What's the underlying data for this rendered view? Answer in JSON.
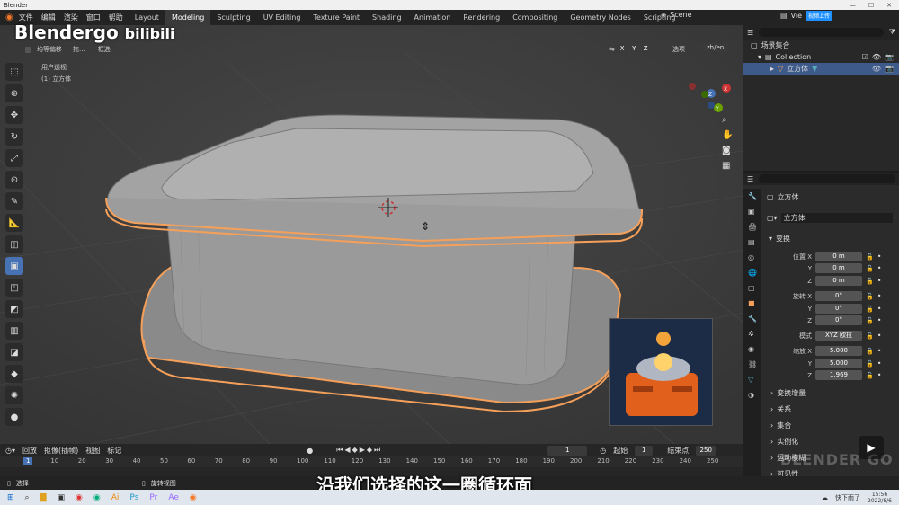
{
  "window": {
    "title": "Blender"
  },
  "menu": [
    "文件",
    "编辑",
    "渲染",
    "窗口",
    "帮助"
  ],
  "workspaces": [
    "Layout",
    "Modeling",
    "Sculpting",
    "UV Editing",
    "Texture Paint",
    "Shading",
    "Animation",
    "Rendering",
    "Compositing",
    "Geometry Nodes",
    "Scripting"
  ],
  "active_workspace": "Modeling",
  "scene": "Scene",
  "view_layer_btn": "Vie",
  "view_layer_badge": "视频上传",
  "watermark_logo": "Blendergo",
  "bilibili_logo": "bilibili",
  "viewport": {
    "options": [
      "均等偏移",
      "拖...",
      "框选"
    ],
    "view_label": "用户透视",
    "object_label": "(1) 立方体",
    "axes": [
      "X",
      "Y",
      "Z"
    ],
    "options_btn": "选项",
    "lang": "zh/en"
  },
  "outliner": {
    "root": "场景集合",
    "collection": "Collection",
    "object": "立方体"
  },
  "properties": {
    "header": "立方体",
    "object_name": "立方体",
    "section_transform": "变换",
    "location_label": "位置 X",
    "location": [
      "0 m",
      "0 m",
      "0 m"
    ],
    "rotation_label": "旋转 X",
    "rotation": [
      "0°",
      "0°",
      "0°"
    ],
    "mode_label": "模式",
    "mode_value": "XYZ 欧拉",
    "scale_label": "缩放 X",
    "scale": [
      "5.000",
      "5.000",
      "1.969"
    ],
    "y": "Y",
    "z": "Z",
    "delta": "变换增量",
    "sections": [
      "关系",
      "集合",
      "实例化",
      "运动模糊",
      "可见性"
    ]
  },
  "timeline": {
    "playback": "回放",
    "keying": "抠像(插帧)",
    "view": "视图",
    "markers": "标记",
    "current_frame": "1",
    "start_label": "起始",
    "start": "1",
    "end_label": "结束点",
    "end": "250",
    "ticks": [
      "1",
      "10",
      "20",
      "30",
      "40",
      "50",
      "60",
      "70",
      "80",
      "90",
      "100",
      "110",
      "120",
      "130",
      "140",
      "150",
      "160",
      "170",
      "180",
      "190",
      "200",
      "210",
      "220",
      "230",
      "240",
      "250"
    ]
  },
  "statusbar": {
    "select": "选择",
    "rotate": "旋转视图"
  },
  "subtitle": "沿我们选择的这一圈循环面",
  "watermark": "BLENDER GO",
  "taskbar": {
    "weather": "快下雨了",
    "time": "15:56",
    "date": "2022/8/6"
  },
  "colors": {
    "accent": "#4772b3",
    "selection": "#f5a05a",
    "bg_viewport": "#3d3d3d"
  }
}
